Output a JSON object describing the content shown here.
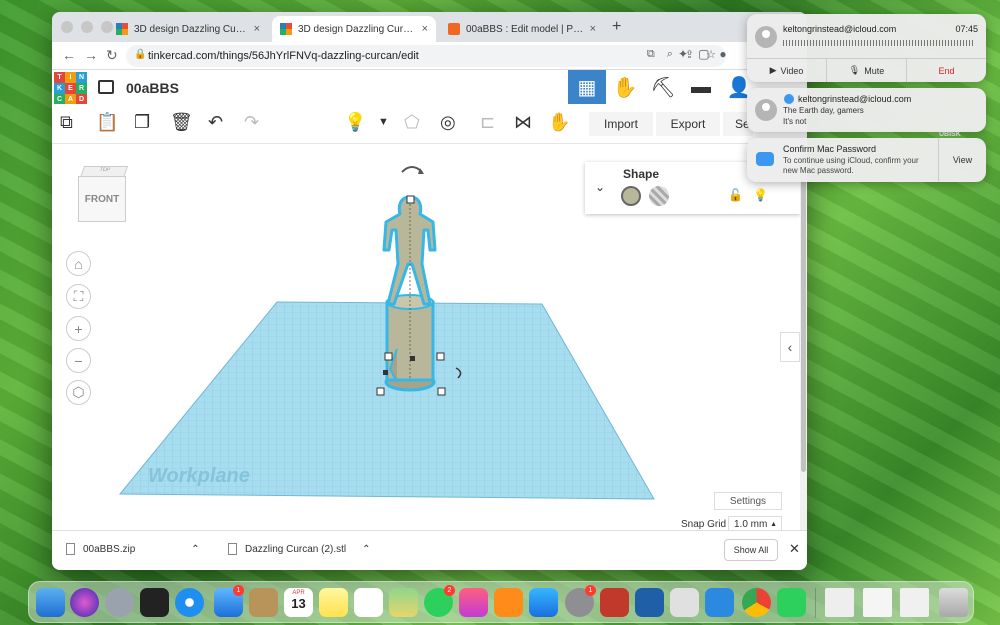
{
  "browser": {
    "tabs": [
      {
        "title": "3D design Dazzling Curcan - Ti",
        "favicon": "tinkercad-favicon",
        "active": false
      },
      {
        "title": "3D design Dazzling Curcan - Ti",
        "favicon": "tinkercad-favicon",
        "active": true
      },
      {
        "title": "00aBBS : Edit model | Printabl",
        "favicon": "printables-favicon",
        "active": false
      }
    ],
    "url": "tinkercad.com/things/56JhYrlFNVq-dazzling-curcan/edit"
  },
  "tinkercad": {
    "logo_letters": [
      "T",
      "I",
      "N",
      "K",
      "E",
      "R",
      "C",
      "A",
      "D"
    ],
    "design_name": "00aBBS",
    "toolbar": {
      "import_label": "Import",
      "export_label": "Export",
      "send_label": "Se"
    },
    "viewcube": {
      "top_label": "TOP",
      "front_label": "FRONT"
    },
    "shape_panel": {
      "title": "Shape",
      "solid_color": "#b9b79a"
    },
    "workplane_label": "Workplane",
    "settings_label": "Settings",
    "snap_grid": {
      "label": "Snap Grid",
      "value": "1.0 mm"
    }
  },
  "downloads": {
    "items": [
      {
        "name": "00aBBS.zip"
      },
      {
        "name": "Dazzling Curcan (2).stl"
      }
    ],
    "show_all_label": "Show All"
  },
  "notifications": {
    "call": {
      "email": "keltongrinstead@icloud.com",
      "time": "07:45",
      "video_label": "Video",
      "mute_label": "Mute",
      "end_label": "End"
    },
    "message": {
      "email": "keltongrinstead@icloud.com",
      "line1": "The Earth day, gamers",
      "line2": "It's not"
    },
    "icloud": {
      "title": "Confirm Mac Password",
      "body": "To continue using iCloud, confirm your new Mac password.",
      "action_label": "View"
    }
  },
  "desktop": {
    "label": "UBISK"
  },
  "dock": {
    "calendar_month": "APR",
    "calendar_day": "13",
    "badges": {
      "mail": "1",
      "messages": "2",
      "settings": "1"
    }
  },
  "colors": {
    "tinkercad_blue": "#3c84c9",
    "workplane": "#a8dcef",
    "selection": "#36b7e8",
    "model": "#b9b79a"
  }
}
